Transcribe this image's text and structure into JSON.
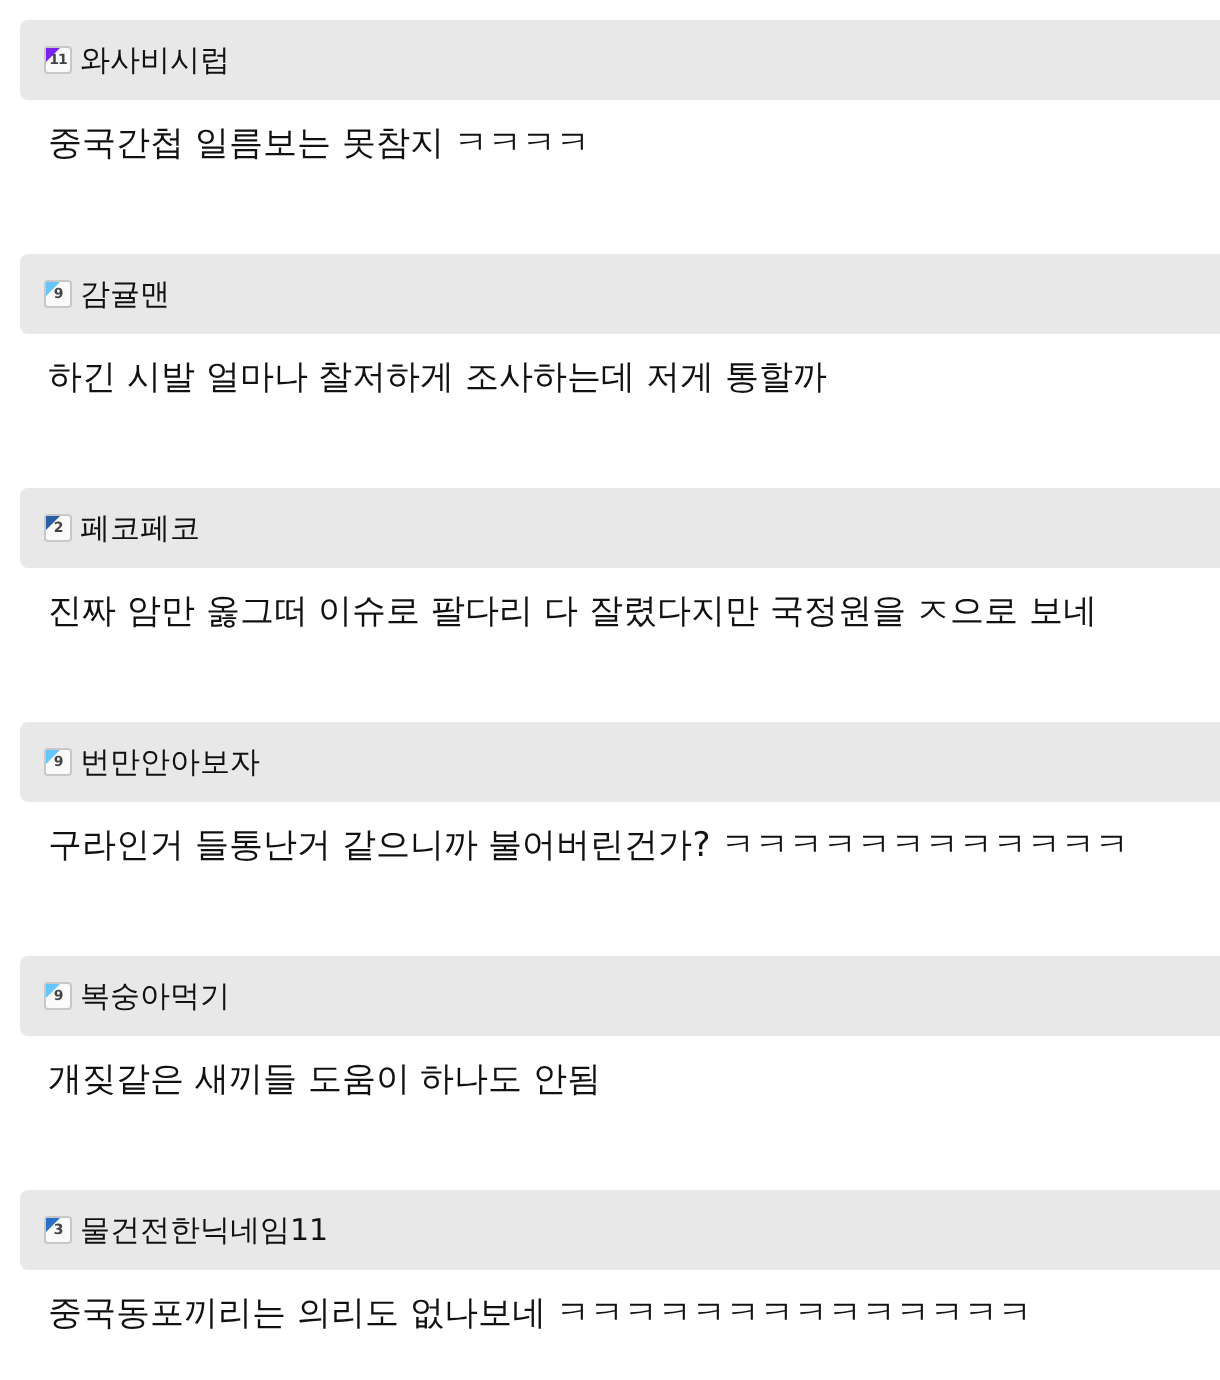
{
  "comments": [
    {
      "level": "11",
      "color": "#7a22ee",
      "nickname": "와사비시럽",
      "text": "중국간첩 일름보는 못참지 ㅋㅋㅋㅋ"
    },
    {
      "level": "9",
      "color": "#66c4ff",
      "nickname": "감귤맨",
      "text": "하긴 시발 얼마나 찰저하게 조사하는데 저게 통할까"
    },
    {
      "level": "2",
      "color": "#2a5fa8",
      "nickname": "페코페코",
      "text": "진짜 암만 옳그떠 이슈로 팔다리 다 잘렸다지만 국정원을 ㅈ으로 보네"
    },
    {
      "level": "9",
      "color": "#66c4ff",
      "nickname": "번만안아보자",
      "text": "구라인거 들통난거 같으니까 불어버린건가? ㅋㅋㅋㅋㅋㅋㅋㅋㅋㅋㅋㅋ"
    },
    {
      "level": "9",
      "color": "#66c4ff",
      "nickname": "복숭아먹기",
      "text": "개짖같은 새끼들 도움이 하나도 안됨"
    },
    {
      "level": "3",
      "color": "#2a6fc8",
      "nickname": "물건전한닉네임11",
      "text": "중국동포끼리는 의리도 없나보네 ㅋㅋㅋㅋㅋㅋㅋㅋㅋㅋㅋㅋㅋㅋ"
    }
  ]
}
